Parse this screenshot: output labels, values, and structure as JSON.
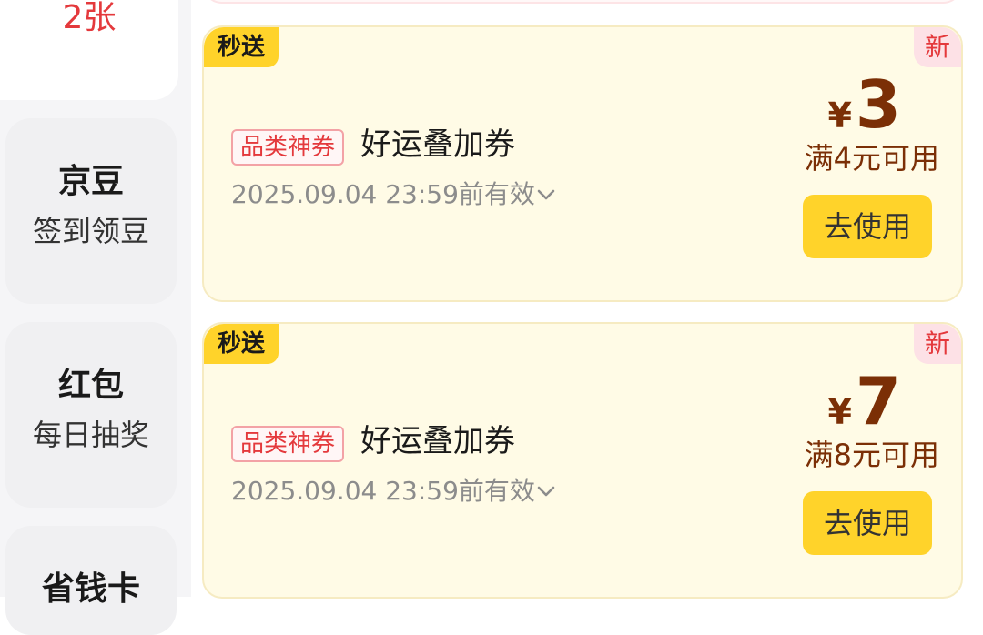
{
  "sidebar": {
    "active_count": "2张",
    "items": [
      {
        "title": "京豆",
        "subtitle": "签到领豆"
      },
      {
        "title": "红包",
        "subtitle": "每日抽奖"
      },
      {
        "title": "省钱卡",
        "subtitle": ""
      }
    ]
  },
  "coupons": [
    {
      "badge": "秒送",
      "new_label": "新",
      "category_tag": "品类神券",
      "name": "好运叠加券",
      "expiry": "2025.09.04 23:59前有效",
      "currency": "¥",
      "amount": "3",
      "condition": "满4元可用",
      "action": "去使用"
    },
    {
      "badge": "秒送",
      "new_label": "新",
      "category_tag": "品类神券",
      "name": "好运叠加券",
      "expiry": "2025.09.04 23:59前有效",
      "currency": "¥",
      "amount": "7",
      "condition": "满8元可用",
      "action": "去使用"
    }
  ],
  "colors": {
    "accent_red": "#e4393c",
    "button_yellow": "#ffd32a",
    "coupon_bg": "#fffbe6",
    "amount_brown": "#7b2f06"
  }
}
